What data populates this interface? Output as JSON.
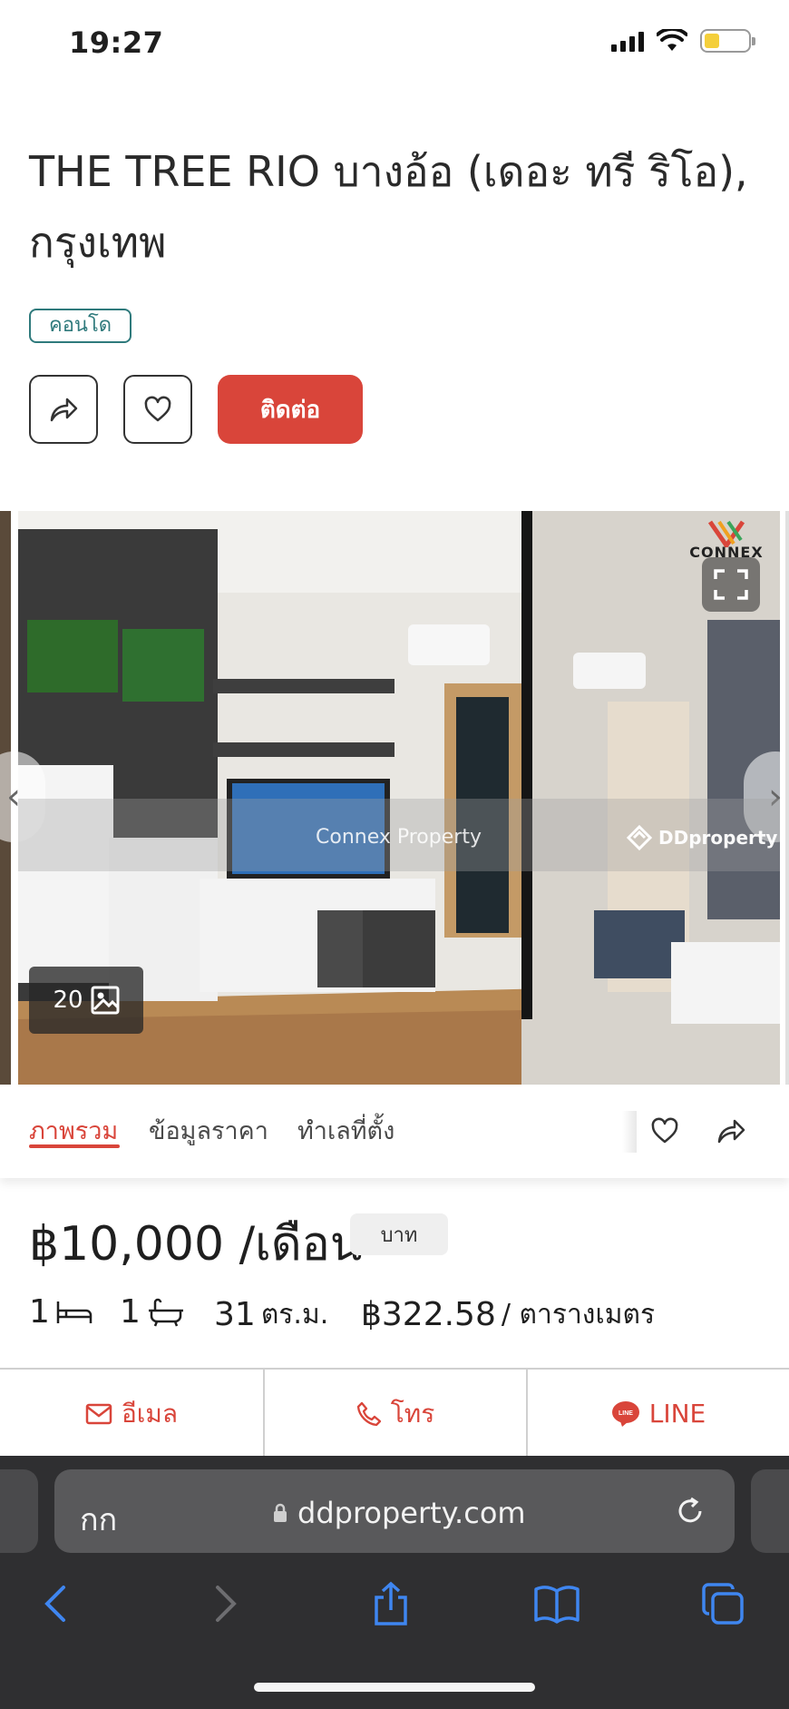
{
  "status_bar": {
    "time": "19:27",
    "icons": [
      "signal-icon",
      "wifi-icon",
      "battery-icon"
    ]
  },
  "listing": {
    "title": "THE TREE RIO บางอ้อ (เดอะ ทรี ริโอ), กรุงเทพ",
    "property_type": "คอนโด",
    "actions": {
      "share_icon": "share-icon",
      "favorite_icon": "heart-icon",
      "contact_label": "ติดต่อ"
    }
  },
  "gallery": {
    "photo_count": "20",
    "watermark_left": "Connex Property",
    "watermark_right": "DDproperty",
    "logo_text": "CONNEX",
    "colors": {
      "accent": "#d9453a",
      "tag": "#2f7a7c"
    }
  },
  "tabs": {
    "items": [
      "ภาพรวม",
      "ข้อมูลราคา",
      "ทำเลที่ตั้ง"
    ],
    "active_index": 0
  },
  "price": {
    "amount": "฿10,000 /เดือน",
    "currency_badge": "บาท"
  },
  "specs": {
    "bedrooms": "1",
    "bathrooms": "1",
    "area": "31",
    "area_unit": "ตร.ม.",
    "price_per_sqm": "฿322.58",
    "price_per_sqm_unit": "/ ตารางเมตร"
  },
  "contact_bar": {
    "email_label": "อีเมล",
    "call_label": "โทร",
    "line_label": "LINE"
  },
  "browser": {
    "aa_label": "กก",
    "url": "ddproperty.com"
  }
}
